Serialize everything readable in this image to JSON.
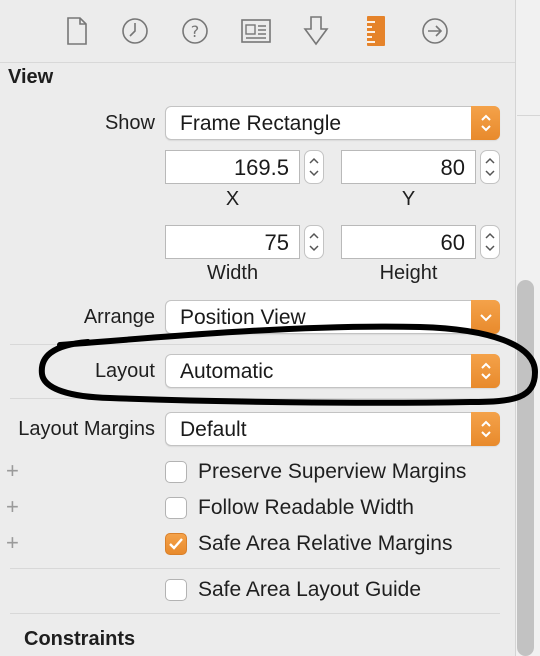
{
  "toolbar": {
    "icons": [
      "file-inspector-icon",
      "history-inspector-icon",
      "quick-help-icon",
      "identity-inspector-icon",
      "attributes-inspector-icon",
      "size-inspector-icon",
      "connections-inspector-icon"
    ],
    "active_color": "#e5832a"
  },
  "view_section": {
    "title": "View",
    "show_label": "Show",
    "show_value": "Frame Rectangle",
    "x_value": "169.5",
    "y_value": "80",
    "x_label": "X",
    "y_label": "Y",
    "width_value": "75",
    "height_value": "60",
    "width_label": "Width",
    "height_label": "Height",
    "arrange_label": "Arrange",
    "arrange_value": "Position View",
    "layout_label": "Layout",
    "layout_value": "Automatic",
    "margins_label": "Layout Margins",
    "margins_value": "Default",
    "checkboxes": [
      {
        "label": "Preserve Superview Margins",
        "checked": false
      },
      {
        "label": "Follow Readable Width",
        "checked": false
      },
      {
        "label": "Safe Area Relative Margins",
        "checked": true
      }
    ],
    "safe_area_guide": {
      "label": "Safe Area Layout Guide",
      "checked": false
    }
  },
  "constraints_section": {
    "title": "Constraints"
  },
  "annotation": {
    "stroke_color": "#000000"
  }
}
